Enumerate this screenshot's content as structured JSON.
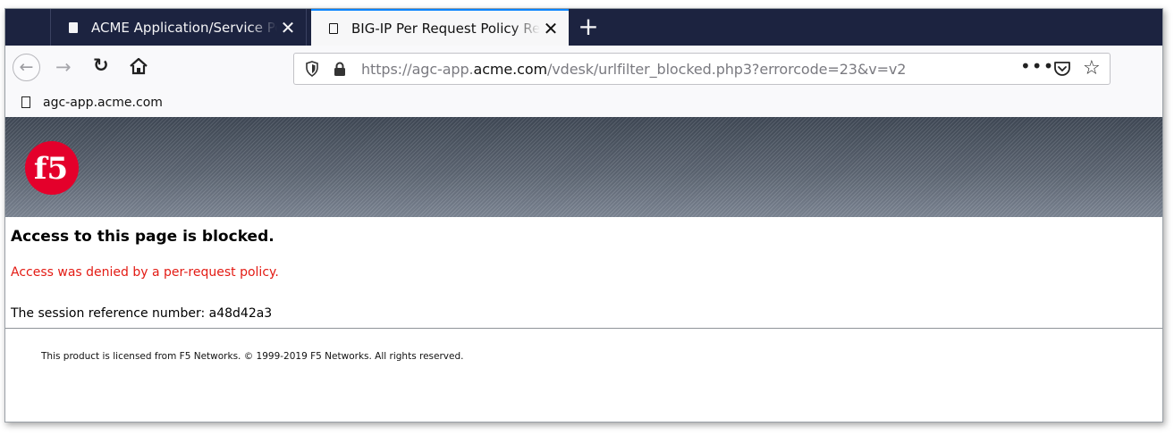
{
  "browser": {
    "tabs": [
      {
        "title": "ACME Application/Service Portal",
        "active": false
      },
      {
        "title": "BIG-IP Per Request Policy Resource",
        "active": true
      }
    ],
    "close_glyph": "✕",
    "new_tab_glyph": "+",
    "url": {
      "scheme": "https://",
      "subdomain": "agc-app.",
      "domain": "acme.com",
      "path": "/vdesk/urlfilter_blocked.php3?errorcode=23&v=v2"
    },
    "bookmark": {
      "label": "agc-app.acme.com"
    },
    "icons": {
      "back": "back-arrow-icon",
      "forward": "forward-arrow-icon",
      "reload": "reload-icon",
      "home": "home-icon",
      "shield": "tracking-shield-icon",
      "lock": "lock-icon",
      "more": "more-dots-icon",
      "pocket": "pocket-icon",
      "bookmark": "star-icon"
    }
  },
  "page": {
    "logo_text": "f5",
    "heading": "Access to this page is blocked.",
    "message": "Access was denied by a per-request policy.",
    "session_label": "The session reference number:",
    "session_number": "a48d42a3",
    "footer": "This product is licensed from F5 Networks. © 1999-2019 F5 Networks. All rights reserved.",
    "colors": {
      "message": "#e31b14",
      "logo": "#e4002b",
      "tabbar": "#1c2340"
    }
  }
}
